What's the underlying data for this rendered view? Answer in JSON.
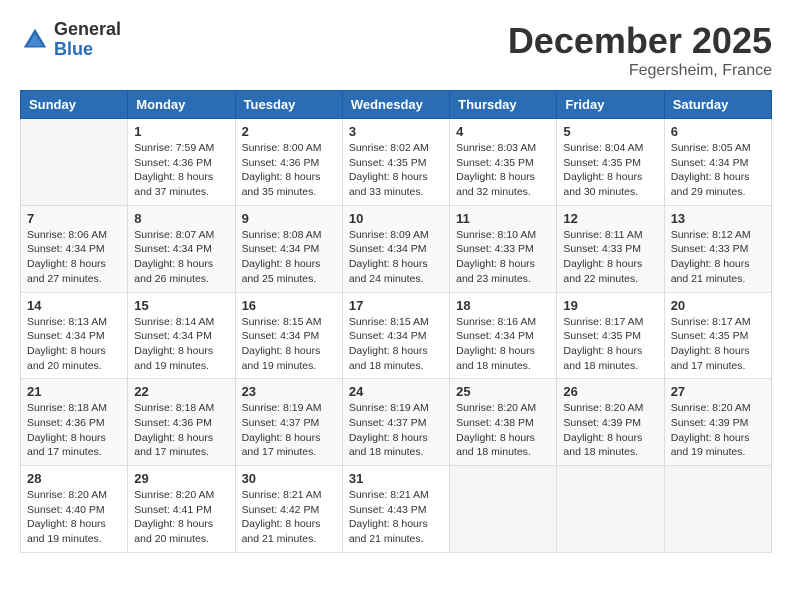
{
  "header": {
    "logo_general": "General",
    "logo_blue": "Blue",
    "month_title": "December 2025",
    "location": "Fegersheim, France"
  },
  "weekdays": [
    "Sunday",
    "Monday",
    "Tuesday",
    "Wednesday",
    "Thursday",
    "Friday",
    "Saturday"
  ],
  "weeks": [
    [
      {
        "day": "",
        "sunrise": "",
        "sunset": "",
        "daylight": ""
      },
      {
        "day": "1",
        "sunrise": "Sunrise: 7:59 AM",
        "sunset": "Sunset: 4:36 PM",
        "daylight": "Daylight: 8 hours and 37 minutes."
      },
      {
        "day": "2",
        "sunrise": "Sunrise: 8:00 AM",
        "sunset": "Sunset: 4:36 PM",
        "daylight": "Daylight: 8 hours and 35 minutes."
      },
      {
        "day": "3",
        "sunrise": "Sunrise: 8:02 AM",
        "sunset": "Sunset: 4:35 PM",
        "daylight": "Daylight: 8 hours and 33 minutes."
      },
      {
        "day": "4",
        "sunrise": "Sunrise: 8:03 AM",
        "sunset": "Sunset: 4:35 PM",
        "daylight": "Daylight: 8 hours and 32 minutes."
      },
      {
        "day": "5",
        "sunrise": "Sunrise: 8:04 AM",
        "sunset": "Sunset: 4:35 PM",
        "daylight": "Daylight: 8 hours and 30 minutes."
      },
      {
        "day": "6",
        "sunrise": "Sunrise: 8:05 AM",
        "sunset": "Sunset: 4:34 PM",
        "daylight": "Daylight: 8 hours and 29 minutes."
      }
    ],
    [
      {
        "day": "7",
        "sunrise": "Sunrise: 8:06 AM",
        "sunset": "Sunset: 4:34 PM",
        "daylight": "Daylight: 8 hours and 27 minutes."
      },
      {
        "day": "8",
        "sunrise": "Sunrise: 8:07 AM",
        "sunset": "Sunset: 4:34 PM",
        "daylight": "Daylight: 8 hours and 26 minutes."
      },
      {
        "day": "9",
        "sunrise": "Sunrise: 8:08 AM",
        "sunset": "Sunset: 4:34 PM",
        "daylight": "Daylight: 8 hours and 25 minutes."
      },
      {
        "day": "10",
        "sunrise": "Sunrise: 8:09 AM",
        "sunset": "Sunset: 4:34 PM",
        "daylight": "Daylight: 8 hours and 24 minutes."
      },
      {
        "day": "11",
        "sunrise": "Sunrise: 8:10 AM",
        "sunset": "Sunset: 4:33 PM",
        "daylight": "Daylight: 8 hours and 23 minutes."
      },
      {
        "day": "12",
        "sunrise": "Sunrise: 8:11 AM",
        "sunset": "Sunset: 4:33 PM",
        "daylight": "Daylight: 8 hours and 22 minutes."
      },
      {
        "day": "13",
        "sunrise": "Sunrise: 8:12 AM",
        "sunset": "Sunset: 4:33 PM",
        "daylight": "Daylight: 8 hours and 21 minutes."
      }
    ],
    [
      {
        "day": "14",
        "sunrise": "Sunrise: 8:13 AM",
        "sunset": "Sunset: 4:34 PM",
        "daylight": "Daylight: 8 hours and 20 minutes."
      },
      {
        "day": "15",
        "sunrise": "Sunrise: 8:14 AM",
        "sunset": "Sunset: 4:34 PM",
        "daylight": "Daylight: 8 hours and 19 minutes."
      },
      {
        "day": "16",
        "sunrise": "Sunrise: 8:15 AM",
        "sunset": "Sunset: 4:34 PM",
        "daylight": "Daylight: 8 hours and 19 minutes."
      },
      {
        "day": "17",
        "sunrise": "Sunrise: 8:15 AM",
        "sunset": "Sunset: 4:34 PM",
        "daylight": "Daylight: 8 hours and 18 minutes."
      },
      {
        "day": "18",
        "sunrise": "Sunrise: 8:16 AM",
        "sunset": "Sunset: 4:34 PM",
        "daylight": "Daylight: 8 hours and 18 minutes."
      },
      {
        "day": "19",
        "sunrise": "Sunrise: 8:17 AM",
        "sunset": "Sunset: 4:35 PM",
        "daylight": "Daylight: 8 hours and 18 minutes."
      },
      {
        "day": "20",
        "sunrise": "Sunrise: 8:17 AM",
        "sunset": "Sunset: 4:35 PM",
        "daylight": "Daylight: 8 hours and 17 minutes."
      }
    ],
    [
      {
        "day": "21",
        "sunrise": "Sunrise: 8:18 AM",
        "sunset": "Sunset: 4:36 PM",
        "daylight": "Daylight: 8 hours and 17 minutes."
      },
      {
        "day": "22",
        "sunrise": "Sunrise: 8:18 AM",
        "sunset": "Sunset: 4:36 PM",
        "daylight": "Daylight: 8 hours and 17 minutes."
      },
      {
        "day": "23",
        "sunrise": "Sunrise: 8:19 AM",
        "sunset": "Sunset: 4:37 PM",
        "daylight": "Daylight: 8 hours and 17 minutes."
      },
      {
        "day": "24",
        "sunrise": "Sunrise: 8:19 AM",
        "sunset": "Sunset: 4:37 PM",
        "daylight": "Daylight: 8 hours and 18 minutes."
      },
      {
        "day": "25",
        "sunrise": "Sunrise: 8:20 AM",
        "sunset": "Sunset: 4:38 PM",
        "daylight": "Daylight: 8 hours and 18 minutes."
      },
      {
        "day": "26",
        "sunrise": "Sunrise: 8:20 AM",
        "sunset": "Sunset: 4:39 PM",
        "daylight": "Daylight: 8 hours and 18 minutes."
      },
      {
        "day": "27",
        "sunrise": "Sunrise: 8:20 AM",
        "sunset": "Sunset: 4:39 PM",
        "daylight": "Daylight: 8 hours and 19 minutes."
      }
    ],
    [
      {
        "day": "28",
        "sunrise": "Sunrise: 8:20 AM",
        "sunset": "Sunset: 4:40 PM",
        "daylight": "Daylight: 8 hours and 19 minutes."
      },
      {
        "day": "29",
        "sunrise": "Sunrise: 8:20 AM",
        "sunset": "Sunset: 4:41 PM",
        "daylight": "Daylight: 8 hours and 20 minutes."
      },
      {
        "day": "30",
        "sunrise": "Sunrise: 8:21 AM",
        "sunset": "Sunset: 4:42 PM",
        "daylight": "Daylight: 8 hours and 21 minutes."
      },
      {
        "day": "31",
        "sunrise": "Sunrise: 8:21 AM",
        "sunset": "Sunset: 4:43 PM",
        "daylight": "Daylight: 8 hours and 21 minutes."
      },
      {
        "day": "",
        "sunrise": "",
        "sunset": "",
        "daylight": ""
      },
      {
        "day": "",
        "sunrise": "",
        "sunset": "",
        "daylight": ""
      },
      {
        "day": "",
        "sunrise": "",
        "sunset": "",
        "daylight": ""
      }
    ]
  ]
}
